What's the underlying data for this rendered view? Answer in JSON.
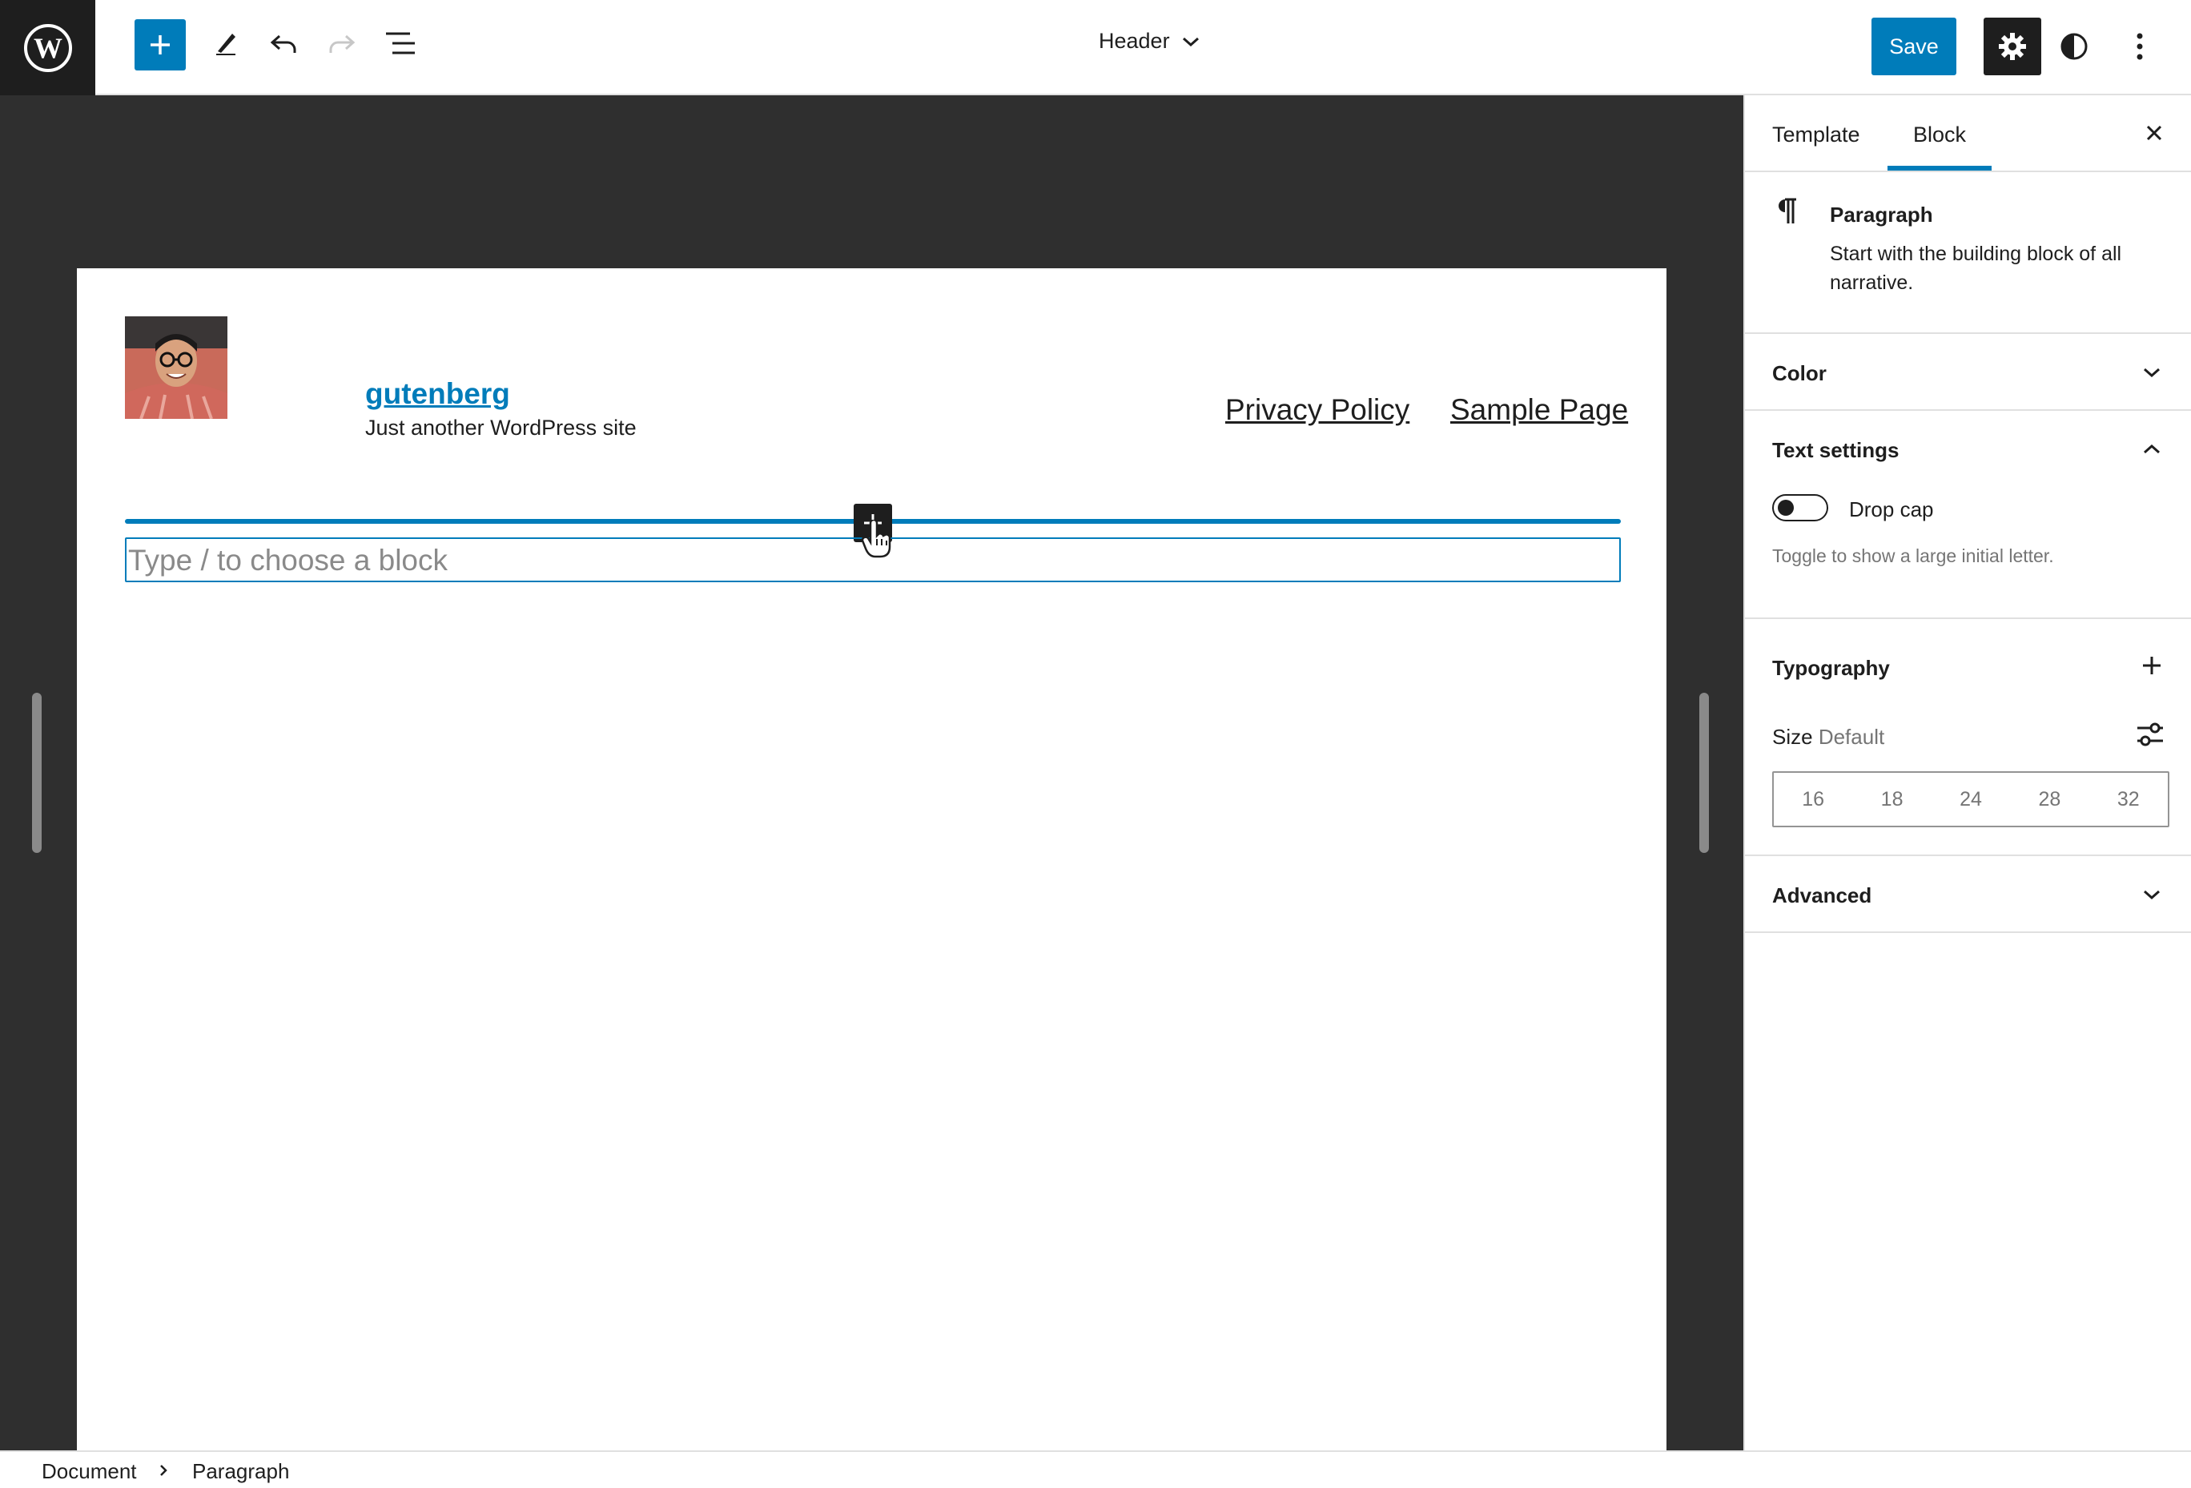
{
  "topbar": {
    "document_title": "Header",
    "save_label": "Save",
    "icons": {
      "logo": "wordpress-logo",
      "inserter": "plus-icon",
      "tools": "pencil-icon",
      "undo": "undo-icon",
      "redo": "redo-icon",
      "list_view": "list-view-icon",
      "title_dropdown": "chevron-down-icon",
      "settings": "gear-icon",
      "styles": "half-circle-contrast-icon",
      "more": "vertical-ellipsis-icon"
    }
  },
  "canvas": {
    "site_title": "gutenberg",
    "site_tagline": "Just another WordPress site",
    "nav_links": [
      "Privacy Policy",
      "Sample Page"
    ],
    "paragraph_placeholder": "Type / to choose a block"
  },
  "sidebar": {
    "tabs": [
      "Template",
      "Block"
    ],
    "active_tab": "Block",
    "block": {
      "name": "Paragraph",
      "description": "Start with the building block of all narrative."
    },
    "panels": {
      "color": "Color",
      "text_settings": "Text settings",
      "drop_cap_label": "Drop cap",
      "drop_cap_help": "Toggle to show a large initial letter.",
      "drop_cap_enabled": false,
      "typography": "Typography",
      "size_label": "Size",
      "size_value": "Default",
      "font_sizes": [
        "16",
        "18",
        "24",
        "28",
        "32"
      ],
      "advanced": "Advanced"
    }
  },
  "breadcrumb": [
    "Document",
    "Paragraph"
  ],
  "colors": {
    "accent": "#007cba",
    "dark": "#1e1e1e",
    "canvas_bg": "#2f2f2f"
  }
}
